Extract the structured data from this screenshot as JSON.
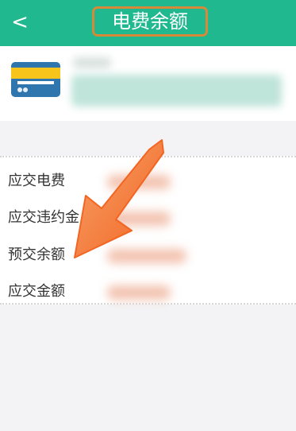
{
  "header": {
    "back_icon": "chevron-left-icon",
    "back_glyph": "<",
    "title": "电费余额",
    "background_color": "#20b88f",
    "highlight_color": "#d7893a"
  },
  "account": {
    "card_icon": "card-icon"
  },
  "details": {
    "rows": [
      {
        "label": "应交电费"
      },
      {
        "label": "应交违约金"
      },
      {
        "label": "预交余额"
      },
      {
        "label": "应交金额"
      }
    ]
  },
  "annotation": {
    "arrow_icon": "arrow-icon",
    "arrow_color": "#f26522"
  }
}
